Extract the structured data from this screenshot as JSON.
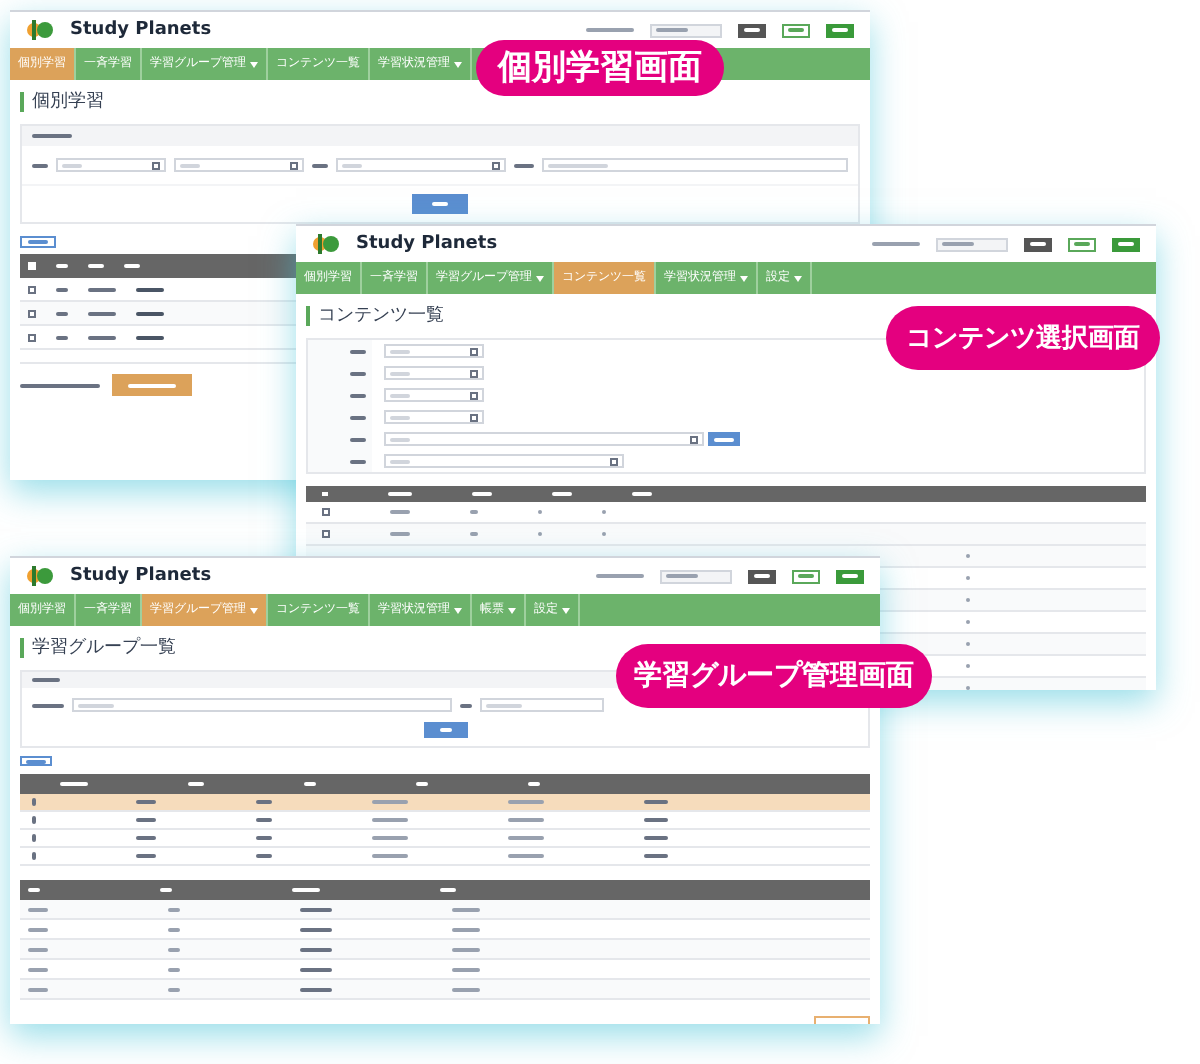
{
  "screens": [
    {
      "kind": "individual",
      "brand": "Study Planets",
      "title": "個別学習",
      "nav": [
        {
          "label": "個別学習",
          "menu": false,
          "selected": true
        },
        {
          "label": "一斉学習",
          "menu": false,
          "selected": false
        },
        {
          "label": "学習グループ管理",
          "menu": true,
          "selected": false
        },
        {
          "label": "コンテンツ一覧",
          "menu": false,
          "selected": false
        },
        {
          "label": "学習状況管理",
          "menu": true,
          "selected": false
        }
      ],
      "rows": [
        {
          "checked": false
        },
        {
          "checked": false
        },
        {
          "checked": false
        }
      ]
    },
    {
      "kind": "contents",
      "brand": "Study Planets",
      "title": "コンテンツ一覧",
      "nav": [
        {
          "label": "個別学習",
          "menu": false,
          "selected": false
        },
        {
          "label": "一斉学習",
          "menu": false,
          "selected": false
        },
        {
          "label": "学習グループ管理",
          "menu": true,
          "selected": false
        },
        {
          "label": "コンテンツ一覧",
          "menu": false,
          "selected": true
        },
        {
          "label": "学習状況管理",
          "menu": true,
          "selected": false
        },
        {
          "label": "設定",
          "menu": true,
          "selected": false
        }
      ],
      "rows": [
        {
          "checked": false
        },
        {
          "checked": false
        }
      ]
    },
    {
      "kind": "groups",
      "brand": "Study Planets",
      "title": "学習グループ一覧",
      "nav": [
        {
          "label": "個別学習",
          "menu": false,
          "selected": false
        },
        {
          "label": "一斉学習",
          "menu": false,
          "selected": false
        },
        {
          "label": "学習グループ管理",
          "menu": true,
          "selected": true
        },
        {
          "label": "コンテンツ一覧",
          "menu": false,
          "selected": false
        },
        {
          "label": "学習状況管理",
          "menu": true,
          "selected": false
        },
        {
          "label": "帳票",
          "menu": true,
          "selected": false
        },
        {
          "label": "設定",
          "menu": true,
          "selected": false
        }
      ],
      "group_rows": [
        {
          "selected": true
        },
        {
          "selected": false
        },
        {
          "selected": false
        },
        {
          "selected": false
        }
      ]
    }
  ],
  "callouts": [
    "個別学習画面",
    "コンテンツ選択画面",
    "学習グループ管理画面"
  ]
}
